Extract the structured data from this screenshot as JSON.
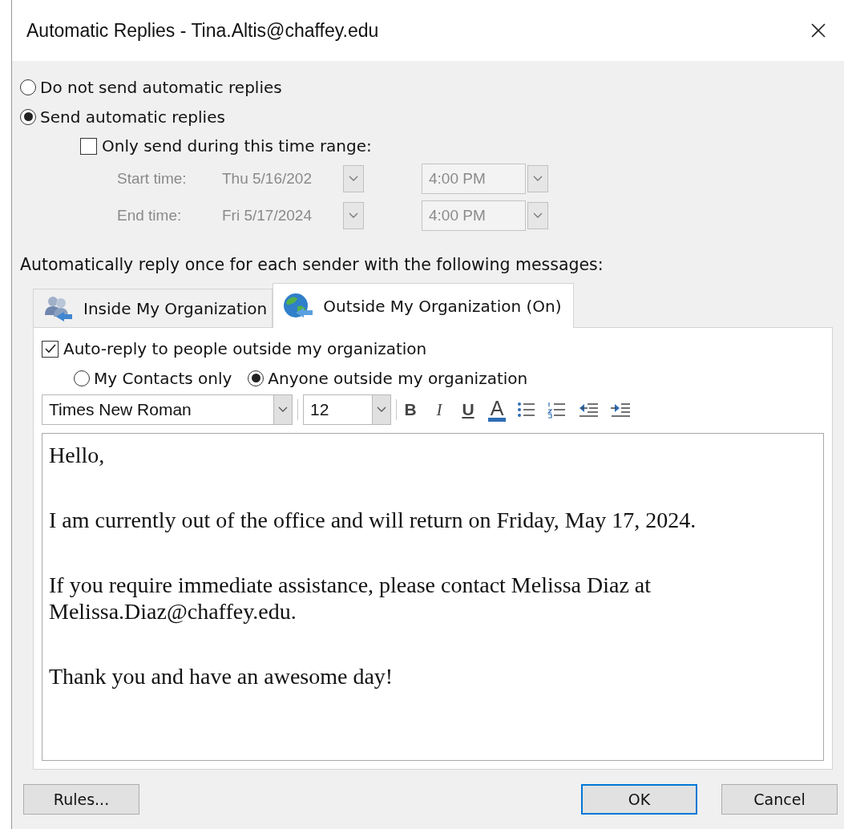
{
  "window": {
    "title": "Automatic Replies - Tina.Altis@chaffey.edu"
  },
  "reply_mode": [
    {
      "label": "Do not send automatic replies",
      "selected": false
    },
    {
      "label": "Send automatic replies",
      "selected": true
    }
  ],
  "time_range": {
    "label": "Only send during this time range:",
    "checked": false,
    "disabled": true,
    "rows": [
      {
        "label": "Start time:",
        "date": "Thu 5/16/202",
        "time": "4:00 PM"
      },
      {
        "label": "End time:",
        "date": "Fri 5/17/2024",
        "time": "4:00 PM"
      }
    ]
  },
  "instruction": "Automatically reply once for each sender with the following messages:",
  "tabs": [
    {
      "label": "Inside My Organization",
      "selected": false,
      "kind": "people"
    },
    {
      "label": "Outside My Organization (On)",
      "selected": true,
      "kind": "globe"
    }
  ],
  "outside": {
    "auto_reply": {
      "label": "Auto-reply to people outside my organization",
      "checked": true
    },
    "audience": [
      {
        "label": "My Contacts only",
        "selected": false
      },
      {
        "label": "Anyone outside my organization",
        "selected": true
      }
    ],
    "font": "Times New Roman",
    "size": "12",
    "format_buttons": [
      {
        "glyph": "B",
        "kind": "bold"
      },
      {
        "glyph": "I",
        "kind": "italic"
      },
      {
        "glyph": "U",
        "kind": "underline"
      },
      {
        "glyph": "A",
        "kind": "color"
      }
    ],
    "message": [
      "Hello,",
      "I am currently out of the office and will return on Friday, May 17, 2024.",
      "If you require immediate assistance, please contact Melissa Diaz at Melissa.Diaz@chaffey.edu.",
      "Thank you and have an awesome day!"
    ]
  },
  "buttons": [
    {
      "label": "Rules...",
      "default": false
    },
    {
      "label": "OK",
      "default": true
    },
    {
      "label": "Cancel",
      "default": false
    }
  ]
}
